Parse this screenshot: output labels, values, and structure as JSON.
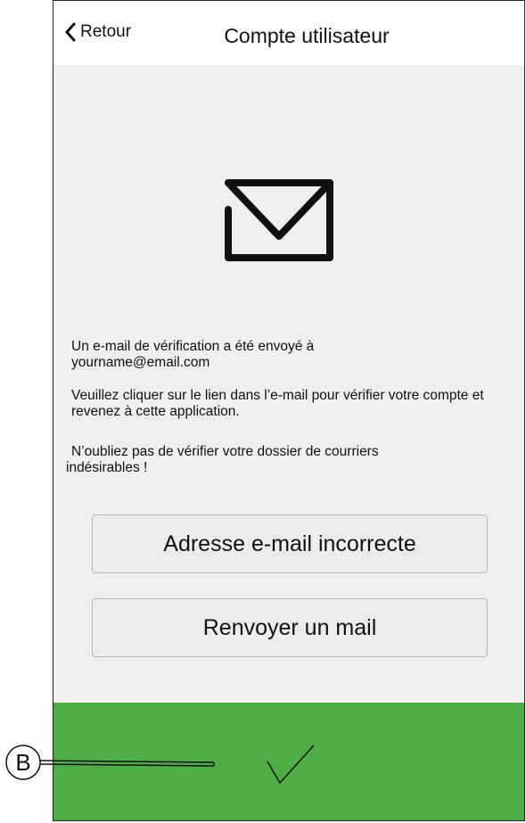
{
  "header": {
    "back_label": "Retour",
    "title": "Compte utilisateur"
  },
  "icons": {
    "back": "chevron-left-icon",
    "mail": "envelope-icon",
    "confirm": "checkmark-icon"
  },
  "message": {
    "line1": "Un e-mail de vérification a été envoyé à",
    "email": "yourname@email.com",
    "line2": "Veuillez cliquer sur le lien dans l’e-mail pour vérifier votre compte et revenez à cette application.",
    "line3a": "N’oubliez pas de vérifier votre dossier de courriers",
    "line3b": "indésirables !"
  },
  "buttons": {
    "wrong_email": "Adresse e-mail incorrecte",
    "resend": "Renvoyer un mail"
  },
  "callout": {
    "label": "B"
  },
  "colors": {
    "footer": "#4cae45",
    "background": "#efefef",
    "header": "#ffffff"
  }
}
